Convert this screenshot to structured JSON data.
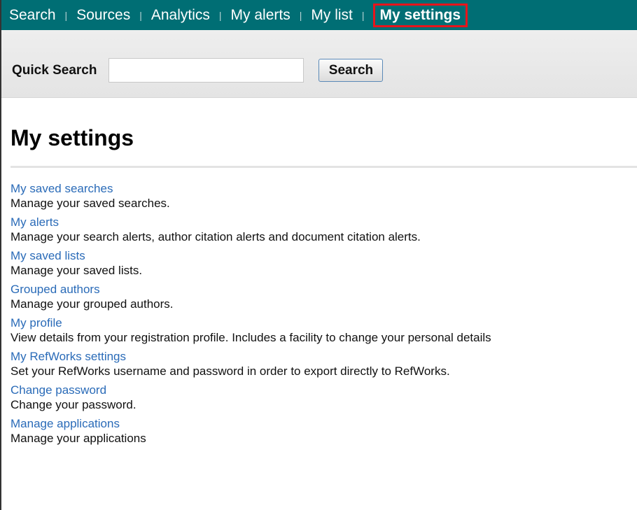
{
  "nav": {
    "items": [
      {
        "label": "Search"
      },
      {
        "label": "Sources"
      },
      {
        "label": "Analytics"
      },
      {
        "label": "My alerts"
      },
      {
        "label": "My list"
      },
      {
        "label": "My settings",
        "active": true
      }
    ],
    "separator": "|"
  },
  "quick_search": {
    "label": "Quick Search",
    "value": "",
    "button_label": "Search"
  },
  "page": {
    "title": "My settings"
  },
  "settings": [
    {
      "link": "My saved searches",
      "description": "Manage your saved searches."
    },
    {
      "link": "My alerts",
      "description": "Manage your search alerts, author citation alerts and document citation alerts."
    },
    {
      "link": "My saved lists",
      "description": "Manage your saved lists."
    },
    {
      "link": "Grouped authors",
      "description": "Manage your grouped authors."
    },
    {
      "link": "My profile",
      "description": "View details from your registration profile. Includes a facility to change your personal details"
    },
    {
      "link": "My RefWorks settings",
      "description": "Set your RefWorks username and password in order to export directly to RefWorks."
    },
    {
      "link": "Change password",
      "description": "Change your password."
    },
    {
      "link": "Manage applications",
      "description": "Manage your applications"
    }
  ],
  "colors": {
    "nav_bg": "#006e74",
    "active_outline": "#e8141b",
    "link": "#2a6bb8"
  }
}
